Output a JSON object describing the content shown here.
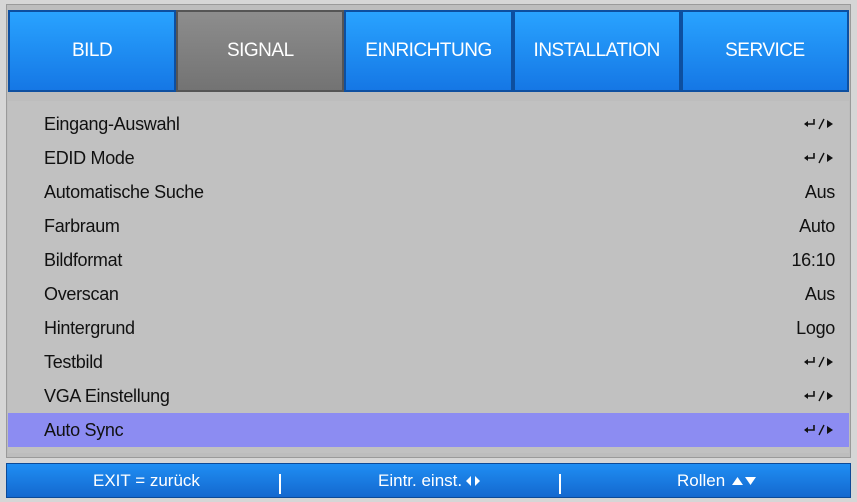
{
  "tabs": [
    {
      "label": "BILD",
      "active": false
    },
    {
      "label": "SIGNAL",
      "active": true
    },
    {
      "label": "EINRICHTUNG",
      "active": false
    },
    {
      "label": "INSTALLATION",
      "active": false
    },
    {
      "label": "SERVICE",
      "active": false
    }
  ],
  "menu": {
    "items": [
      {
        "label": "Eingang-Auswahl",
        "value": "",
        "icon": "enter-right-icon"
      },
      {
        "label": "EDID Mode",
        "value": "",
        "icon": "enter-right-icon"
      },
      {
        "label": "Automatische Suche",
        "value": "Aus"
      },
      {
        "label": "Farbraum",
        "value": "Auto"
      },
      {
        "label": "Bildformat",
        "value": "16:10"
      },
      {
        "label": "Overscan",
        "value": "Aus"
      },
      {
        "label": "Hintergrund",
        "value": "Logo"
      },
      {
        "label": "Testbild",
        "value": "",
        "icon": "enter-right-icon"
      },
      {
        "label": "VGA Einstellung",
        "value": "",
        "icon": "enter-right-icon"
      },
      {
        "label": "Auto Sync",
        "value": "",
        "icon": "enter-right-icon",
        "selected": true
      }
    ]
  },
  "footer": {
    "exit": "EXIT = zurück",
    "adjust": "Eintr. einst.",
    "scroll": "Rollen",
    "separator": "|"
  },
  "colors": {
    "tab_blue": "#1f8ef3",
    "tab_active": "#808080",
    "menu_bg": "#c1c1c1",
    "selected_row": "#8c8cf2",
    "footer_blue": "#1f8ef3"
  }
}
